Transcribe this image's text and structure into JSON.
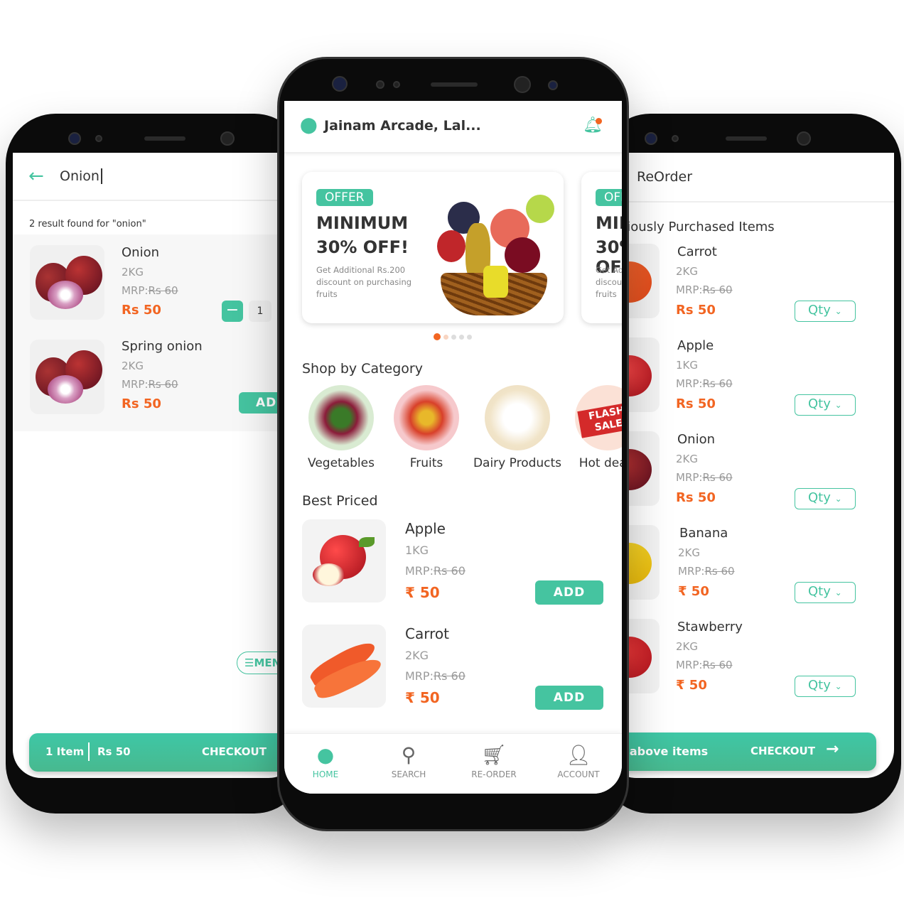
{
  "colors": {
    "accent": "#45c4a0",
    "price": "#f26522",
    "text": "#333333"
  },
  "left_screen": {
    "search_value": "Onion",
    "result_text": "2 result found for \"onion\"",
    "items": [
      {
        "name": "Onion",
        "weight": "2KG",
        "mrp_label": "MRP:",
        "mrp": "Rs 60",
        "price": "Rs 50",
        "qty": "1"
      },
      {
        "name": "Spring onion",
        "weight": "2KG",
        "mrp_label": "MRP:",
        "mrp": "Rs 60",
        "price": "Rs 50",
        "add_label": "ADD"
      }
    ],
    "menu_label": "MENU",
    "cart": {
      "items": "1 Item",
      "total": "Rs 50",
      "checkout": "CHECKOUT"
    }
  },
  "center_screen": {
    "location": "Jainam Arcade, Lal...",
    "banner": {
      "badge": "OFFER",
      "title_line1": "MINIMUM",
      "title_line2": "30% OFF!",
      "description": "Get Additional Rs.200 discount on purchasing fruits"
    },
    "carousel": {
      "pages": 5,
      "active": 1
    },
    "categories_title": "Shop by Category",
    "categories": [
      {
        "label": "Vegetables"
      },
      {
        "label": "Fruits"
      },
      {
        "label": "Dairy Products"
      },
      {
        "label": "Hot deals",
        "image_text": "FLASH SALE"
      }
    ],
    "best_priced_title": "Best Priced",
    "best_priced": [
      {
        "name": "Apple",
        "weight": "1KG",
        "mrp_label": "MRP:",
        "mrp": "Rs 60",
        "price": "₹ 50",
        "add_label": "ADD"
      },
      {
        "name": "Carrot",
        "weight": "2KG",
        "mrp_label": "MRP:",
        "mrp": "Rs 60",
        "price": "₹ 50",
        "add_label": "ADD"
      }
    ],
    "nav": [
      {
        "label": "HOME",
        "icon": "home-apple-icon",
        "active": true
      },
      {
        "label": "SEARCH",
        "icon": "search-icon"
      },
      {
        "label": "RE-ORDER",
        "icon": "cart-icon"
      },
      {
        "label": "ACCOUNT",
        "icon": "user-icon"
      }
    ]
  },
  "right_screen": {
    "title": "ReOrder",
    "section_title": "Previously Purchased Items",
    "qty_label": "Qty",
    "items": [
      {
        "name": "Carrot",
        "weight": "2KG",
        "mrp_label": "MRP:",
        "mrp": "Rs 60",
        "price": "Rs 50"
      },
      {
        "name": "Apple",
        "weight": "1KG",
        "mrp_label": "MRP:",
        "mrp": "Rs 60",
        "price": "Rs 50"
      },
      {
        "name": "Onion",
        "weight": "2KG",
        "mrp_label": "MRP:",
        "mrp": "Rs 60",
        "price": "Rs 50"
      },
      {
        "name": "Banana",
        "weight": "2KG",
        "mrp_label": "MRP:",
        "mrp": "Rs 60",
        "price": "₹ 50"
      },
      {
        "name": "Stawberry",
        "weight": "2KG",
        "mrp_label": "MRP:",
        "mrp": "Rs 60",
        "price": "₹ 50"
      }
    ],
    "cart": {
      "label": "Add above items",
      "checkout": "CHECKOUT"
    }
  }
}
